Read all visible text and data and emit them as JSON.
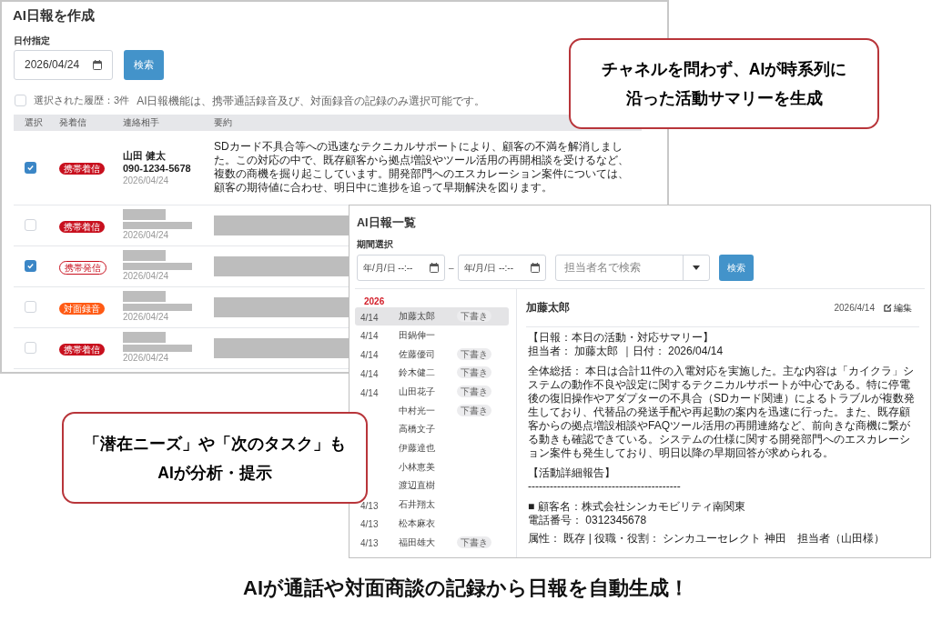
{
  "report_create": {
    "title": "AI日報を作成",
    "date_label": "日付指定",
    "date_value": "2026/04/24",
    "search_button": "検索",
    "select_all_checked": false,
    "selected_count": "選択された履歴：3件",
    "note": "AI日報機能は、携帯通話録音及び、対面録音の記録のみ選択可能です。",
    "columns": [
      "選択",
      "発着信",
      "連絡相手",
      "要約"
    ],
    "rows": [
      {
        "checked": true,
        "badge": {
          "kind": "incoming",
          "label": "携帯着信"
        },
        "name": "山田 健太",
        "phone": "090-1234-5678",
        "date": "2026/04/24",
        "summary": "SDカード不具合等への迅速なテクニカルサポートにより、顧客の不満を解消しました。この対応の中で、既存顧客から拠点増設やツール活用の再開相談を受けるなど、複数の商機を掘り起こしています。開発部門へのエスカレーション案件については、顧客の期待値に合わせ、明日中に進捗を追って早期解決を図ります。"
      },
      {
        "checked": false,
        "badge": {
          "kind": "incoming",
          "label": "携帯着信"
        },
        "date": "2026/04/24"
      },
      {
        "checked": true,
        "badge": {
          "kind": "outgoing",
          "label": "携帯発信"
        },
        "date": "2026/04/24"
      },
      {
        "checked": false,
        "badge": {
          "kind": "face",
          "label": "対面録音"
        },
        "date": "2026/04/24"
      },
      {
        "checked": false,
        "badge": {
          "kind": "incoming",
          "label": "携帯着信"
        },
        "date": "2026/04/24"
      }
    ]
  },
  "report_list": {
    "title": "AI日報一覧",
    "period_label": "期間選択",
    "start_placeholder": "年/月/日 --:--",
    "separator": "–",
    "end_placeholder": "年/月/日 --:--",
    "staff_placeholder": "担当者名で検索",
    "search_button": "検索",
    "year": "2026",
    "entries": [
      {
        "date": "4/14",
        "name": "加藤太郎",
        "badge": "下書き",
        "selected": true
      },
      {
        "date": "4/14",
        "name": "田鍋伸一",
        "selected": false
      },
      {
        "date": "4/14",
        "name": "佐藤優司",
        "badge": "下書き",
        "selected": false
      },
      {
        "date": "4/14",
        "name": "鈴木健二",
        "badge": "下書き",
        "selected": false
      },
      {
        "date": "4/14",
        "name": "山田花子",
        "badge": "下書き",
        "selected": false
      },
      {
        "name": "中村光一",
        "badge": "下書き",
        "selected": false
      },
      {
        "name": "高橋文子",
        "selected": false
      },
      {
        "name": "伊藤達也",
        "selected": false
      },
      {
        "name": "小林恵美",
        "selected": false
      },
      {
        "name": "渡辺直樹",
        "selected": false
      },
      {
        "date": "4/13",
        "name": "石井翔太",
        "selected": false
      },
      {
        "date": "4/13",
        "name": "松本麻衣",
        "selected": false
      },
      {
        "date": "4/13",
        "name": "福田雄大",
        "badge": "下書き",
        "selected": false
      }
    ],
    "detail": {
      "name": "加藤太郎",
      "date": "2026/4/14",
      "edit": "編集",
      "paragraphs": [
        "【日報：本日の活動・対応サマリー】",
        "担当者： 加藤太郎 ｜日付： 2026/04/14",
        "全体総括： 本日は合計11件の入電対応を実施した。主な内容は「カイクラ」システムの動作不良や設定に関するテクニカルサポートが中心である。特に停電後の復旧操作やアダプターの不具合（SDカード関連）によるトラブルが複数発生しており、代替品の発送手配や再起動の案内を迅速に行った。また、既存顧客からの拠点増設相談やFAQツール活用の再開連絡など、前向きな商機に繋がる動きも確認できている。システムの仕様に関する開発部門へのエスカレーション案件も発生しており、明日以降の早期回答が求められる。",
        "【活動詳細報告】",
        "------------------------------------------",
        "■ 顧客名：株式会社シンカモビリティ南関東",
        "電話番号： 0312345678",
        "属性： 既存 | 役職・役割： シンカユーセレクト 神田　担当者（山田様）"
      ]
    }
  },
  "callouts": [
    {
      "lines": [
        "チャネルを問わず、AIが時系列に",
        "沿った活動サマリーを生成"
      ]
    },
    {
      "lines": [
        "「潜在ニーズ」や「次のタスク」も",
        "AIが分析・提示"
      ]
    }
  ],
  "caption": "AIが通話や対面商談の記録から日報を自動生成！"
}
